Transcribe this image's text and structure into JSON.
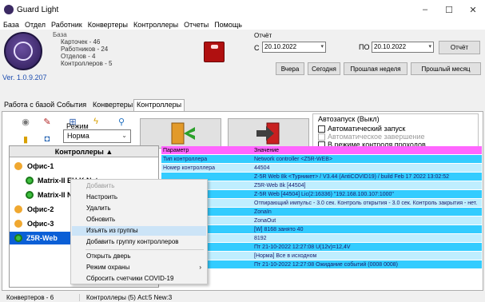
{
  "window": {
    "title": "Guard Light",
    "minimize": "–",
    "maximize": "☐",
    "close": "✕"
  },
  "menu": [
    "База",
    "Отдел",
    "Работник",
    "Конвертеры",
    "Контроллеры",
    "Отчеты",
    "Помощь"
  ],
  "header": {
    "version": "Ver. 1.0.9.207",
    "stats_title": "База",
    "stats": [
      "Карточек - 46",
      "Работников - 24",
      "Отделов - 4",
      "Контроллеров - 5"
    ]
  },
  "report": {
    "label": "Отчёт",
    "from_label": "С",
    "from_date": "20.10.2022",
    "to_label": "ПО",
    "to_date": "20.10.2022",
    "report_button": "Отчёт",
    "yesterday": "Вчера",
    "today": "Сегодня",
    "last_week": "Прошлая неделя",
    "last_month": "Прошлый месяц"
  },
  "tabs": [
    "Работа с базой",
    "События",
    "Конвертеры",
    "Контроллеры"
  ],
  "active_tab": "Контроллеры",
  "toolbar": {
    "mode_label": "Режим",
    "mode_value": "Норма"
  },
  "autostart": {
    "title": "Автозапуск (Выкл)",
    "auto_start": "Автоматический запуск",
    "auto_finish": "Автоматическое завершение",
    "control_mode": "В режиме контроля проходов"
  },
  "tree": {
    "header": "Контроллеры ▲",
    "rows": [
      "Офис-1",
      "Matrix-II EH K Net",
      "Matrix-II Net",
      "Офис-2",
      "Офис-3",
      "Z5R-Web"
    ]
  },
  "params": {
    "col_param": "Параметр",
    "col_value": "Значение",
    "rows": [
      [
        "Тип контроллера",
        "Network controller <Z5R-WEB>"
      ],
      [
        "Номер контроллера",
        "44504"
      ],
      [
        "",
        "Z-5R Web 8k <Турникет> / V3.44 (AntiCOVID19) / build Feb 17 2022  13:02:52"
      ],
      [
        "установки)",
        "Z5R-Web 8k  [44504]"
      ],
      [
        "",
        "Z-5R Web [44504] Lic(2:16336) \"192.168.100.107:1000\""
      ],
      [
        "",
        "Отпирающий импульс - 3.0 сек. Контроль открытия - 3.0 сек. Контроль закрытия - нет."
      ],
      [
        "",
        "ZonaIn"
      ],
      [
        "",
        "ZonaOut"
      ],
      [
        "",
        "[W] 8168 занято 40"
      ],
      [
        "",
        "8192"
      ],
      [
        "",
        "Пт 21-10-2022 12:27:08  U(12v)=12,4V"
      ],
      [
        "ь",
        "[Норма] Все в исходном"
      ],
      [
        "",
        "Пт 21-10-2022 12:27:08 Ожидание событий (0008 0008)"
      ]
    ]
  },
  "context_menu": {
    "add": "Добавить",
    "configure": "Настроить",
    "delete": "Удалить",
    "refresh": "Обновить",
    "remove_from_group": "Изъять из группы",
    "add_group": "Добавить группу контроллеров",
    "open_door": "Открыть дверь",
    "security_mode": "Режим охраны",
    "reset_covid": "Сбросить счетчики COVID-19"
  },
  "status": {
    "converters": "Конвертеров - 6",
    "controllers": "Контроллеры (5) Act:5 New:3"
  }
}
